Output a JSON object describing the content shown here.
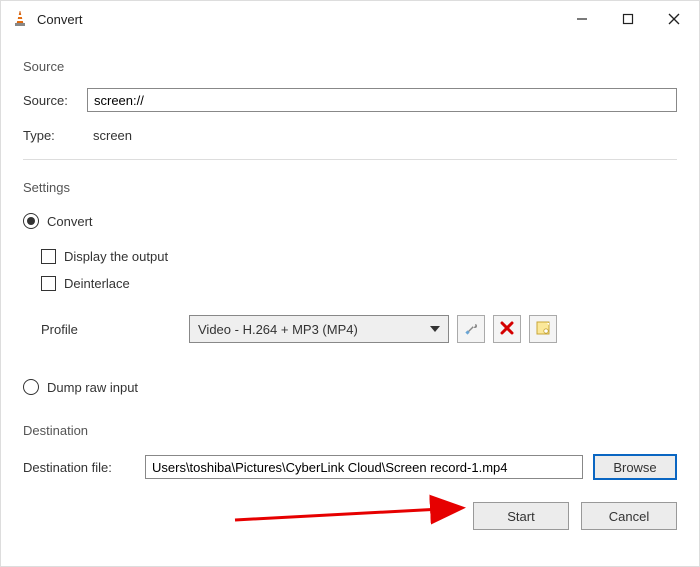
{
  "titlebar": {
    "title": "Convert"
  },
  "source_section": {
    "heading": "Source",
    "source_label": "Source:",
    "source_value": "screen://",
    "type_label": "Type:",
    "type_value": "screen"
  },
  "settings_section": {
    "heading": "Settings",
    "convert_label": "Convert",
    "display_output_label": "Display the output",
    "deinterlace_label": "Deinterlace",
    "profile_label": "Profile",
    "profile_selected": "Video - H.264 + MP3 (MP4)",
    "dump_raw_label": "Dump raw input"
  },
  "destination_section": {
    "heading": "Destination",
    "dest_file_label": "Destination file:",
    "dest_file_value": "Users\\toshiba\\Pictures\\CyberLink Cloud\\Screen record-1.mp4",
    "browse_label": "Browse"
  },
  "footer": {
    "start_label": "Start",
    "cancel_label": "Cancel"
  },
  "icons": {
    "minimize": "minimize-icon",
    "maximize": "maximize-icon",
    "close": "close-icon",
    "wrench": "wrench-icon",
    "delete": "delete-icon",
    "new_profile": "new-profile-icon",
    "app": "vlc-icon"
  }
}
